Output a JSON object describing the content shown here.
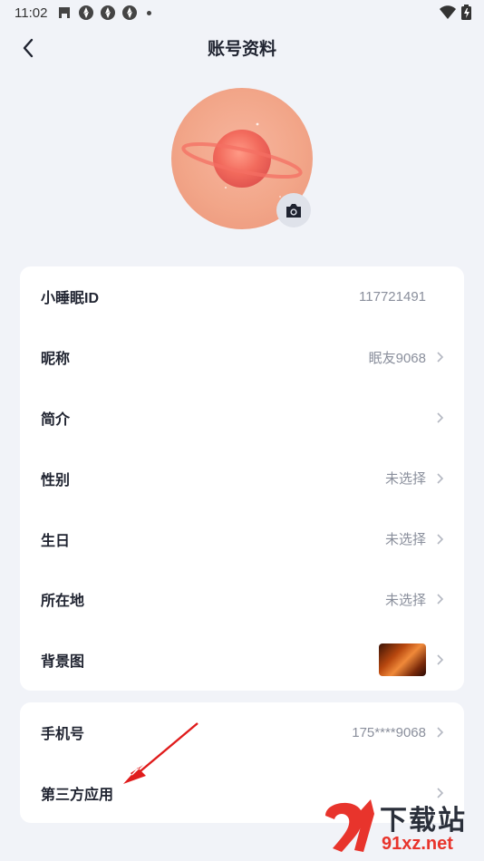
{
  "status_bar": {
    "time": "11:02",
    "icons": [
      "notification-icon",
      "app-icon",
      "app-icon",
      "app-icon",
      "dot-icon"
    ],
    "right_icons": [
      "wifi-icon",
      "battery-icon"
    ]
  },
  "header": {
    "title": "账号资料",
    "back_icon": "back-arrow-icon"
  },
  "profile": {
    "avatar_icon": "planet-avatar",
    "camera_icon": "camera-icon"
  },
  "info_rows": [
    {
      "label": "小睡眠ID",
      "value": "117721491",
      "chevron": false
    },
    {
      "label": "昵称",
      "value": "眠友9068",
      "chevron": true
    },
    {
      "label": "简介",
      "value": "",
      "chevron": true
    },
    {
      "label": "性别",
      "value": "未选择",
      "chevron": true
    },
    {
      "label": "生日",
      "value": "未选择",
      "chevron": true
    },
    {
      "label": "所在地",
      "value": "未选择",
      "chevron": true
    },
    {
      "label": "背景图",
      "value": "",
      "chevron": true
    }
  ],
  "account_rows": [
    {
      "label": "手机号",
      "value": "175****9068",
      "chevron": true
    },
    {
      "label": "第三方应用",
      "value": "",
      "chevron": true
    }
  ],
  "watermark": {
    "title": "下载站",
    "url": "91xz.net",
    "logo_color": "#e8342c"
  },
  "colors": {
    "background": "#f1f3f8",
    "card": "#ffffff",
    "annotation_arrow": "#e01b1b",
    "avatar": "#f2a689"
  }
}
